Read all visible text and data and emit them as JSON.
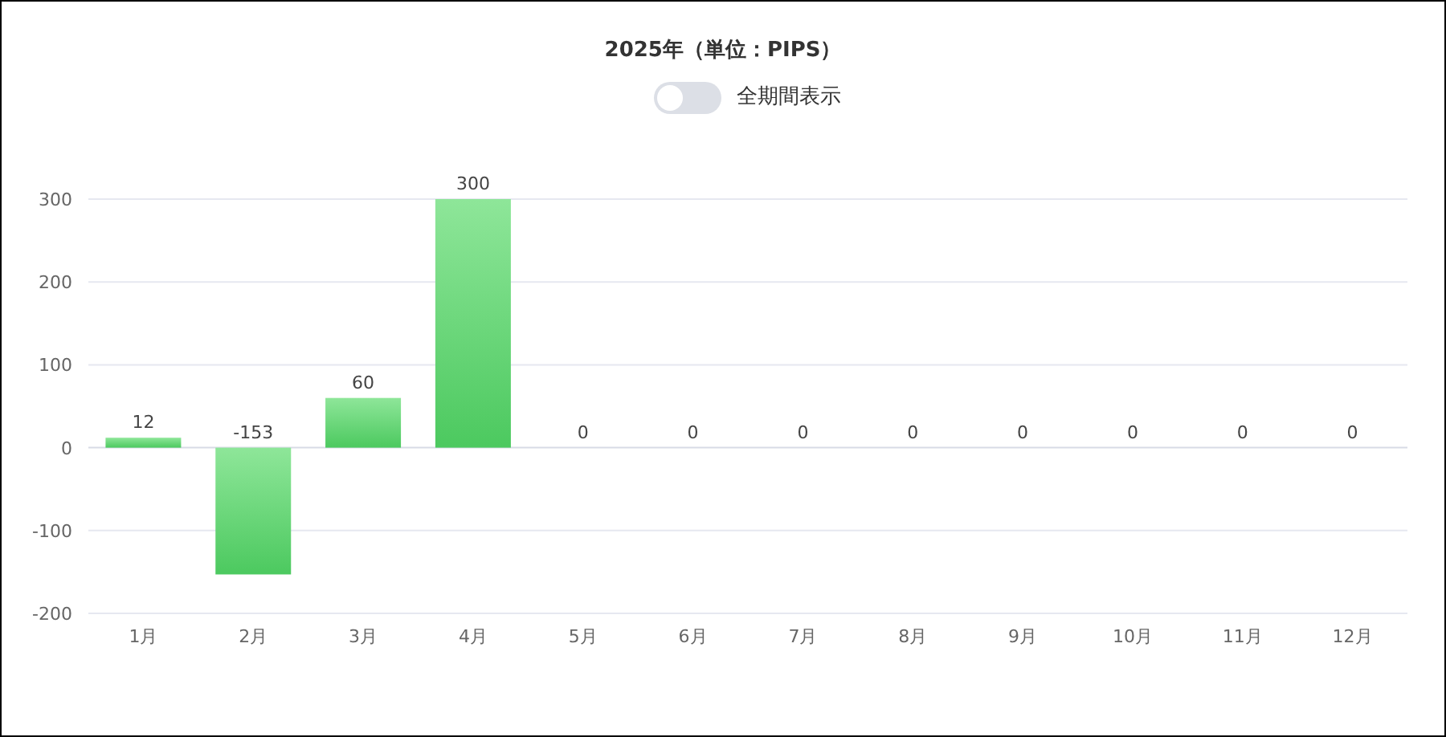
{
  "title": "2025年（単位：PIPS）",
  "toggle": {
    "label": "全期間表示",
    "on": false
  },
  "chart_data": {
    "type": "bar",
    "categories": [
      "1月",
      "2月",
      "3月",
      "4月",
      "5月",
      "6月",
      "7月",
      "8月",
      "9月",
      "10月",
      "11月",
      "12月"
    ],
    "series": [
      {
        "color": "#4cc95f",
        "values": [
          12,
          -153,
          60,
          300,
          0,
          0,
          0,
          0,
          0,
          0,
          0,
          0
        ]
      }
    ],
    "ylim": [
      -200,
      300
    ],
    "yticks": [
      -200,
      -100,
      0,
      100,
      200,
      300
    ],
    "grid": true,
    "data_labels": true
  }
}
